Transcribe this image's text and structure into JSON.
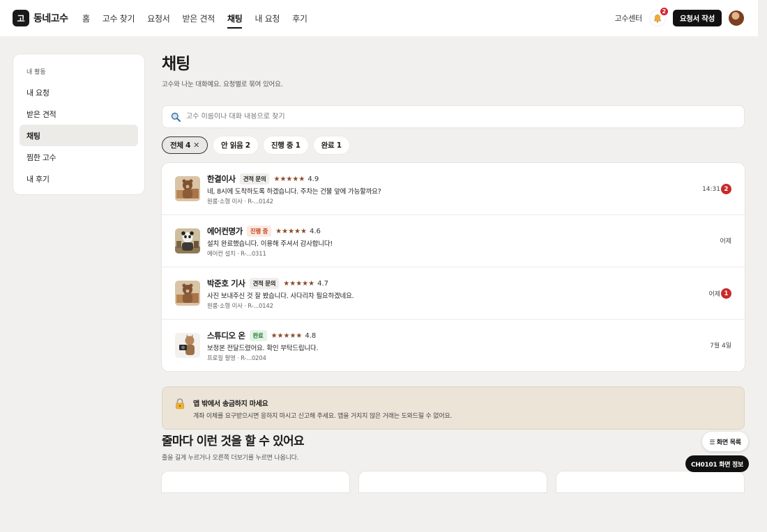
{
  "header": {
    "logo_char": "고",
    "brand": "동네고수",
    "nav": [
      {
        "label": "홈",
        "active": false
      },
      {
        "label": "고수 찾기",
        "active": false
      },
      {
        "label": "요청서",
        "active": false
      },
      {
        "label": "받은 견적",
        "active": false
      },
      {
        "label": "채팅",
        "active": true
      },
      {
        "label": "내 요청",
        "active": false
      },
      {
        "label": "후기",
        "active": false
      }
    ],
    "center_link": "고수센터",
    "notification_count": "2",
    "write_button": "요청서 작성"
  },
  "sidebar": {
    "heading": "내 활동",
    "items": [
      {
        "label": "내 요청",
        "active": false
      },
      {
        "label": "받은 견적",
        "active": false
      },
      {
        "label": "채팅",
        "active": true
      },
      {
        "label": "찜한 고수",
        "active": false
      },
      {
        "label": "내 후기",
        "active": false
      }
    ]
  },
  "page": {
    "title": "채팅",
    "subtitle": "고수와 나눈 대화예요. 요청별로 묶여 있어요."
  },
  "search": {
    "placeholder": "고수 이름이나 대화 내용으로 찾기",
    "value": ""
  },
  "filters": [
    {
      "label": "전체 4",
      "active": true
    },
    {
      "label": "안 읽음 2",
      "active": false
    },
    {
      "label": "진행 중 1",
      "active": false
    },
    {
      "label": "완료 1",
      "active": false
    }
  ],
  "chats": [
    {
      "name": "한결이사",
      "tag": "견적 문의",
      "tag_style": "gray",
      "stars": "★★★★★",
      "rating": "4.9",
      "message": "네, 8시에 도착하도록 하겠습니다. 주차는 건물 앞에 가능할까요?",
      "meta": "원룸·소형 이사 · R-...0142",
      "time": "14:31",
      "unread": "2",
      "thumb": "bear-boxes"
    },
    {
      "name": "에어컨명가",
      "tag": "진행 중",
      "tag_style": "orange",
      "stars": "★★★★★",
      "rating": "4.6",
      "message": "설치 완료했습니다. 이용해 주셔서 감사합니다!",
      "meta": "에어컨 설치 · R-...0311",
      "time": "어제",
      "unread": "",
      "thumb": "panda-worker"
    },
    {
      "name": "박준호 기사",
      "tag": "견적 문의",
      "tag_style": "gray",
      "stars": "★★★★★",
      "rating": "4.7",
      "message": "사진 보내주신 것 잘 봤습니다. 사다리차 필요하겠네요.",
      "meta": "원룸·소형 이사 · R-...0142",
      "time": "어제",
      "unread": "1",
      "thumb": "bear-boxes"
    },
    {
      "name": "스튜디오 온",
      "tag": "완료",
      "tag_style": "green",
      "stars": "★★★★★",
      "rating": "4.8",
      "message": "보정본 전달드렸어요. 확인 부탁드립니다.",
      "meta": "프로필 촬영 · R-...0204",
      "time": "7월 4일",
      "unread": "",
      "thumb": "cat-camera"
    }
  ],
  "notice": {
    "title": "앱 밖에서 송금하지 마세요",
    "body": "계좌 이체를 요구받으시면 응하지 마시고 신고해 주세요. 앱을 거치지 않은 거래는 도와드릴 수 없어요."
  },
  "section": {
    "title": "줄마다 이런 것을 할 수 있어요",
    "subtitle": "줄을 길게 누르거나 오른쪽 더보기를 누르면 나옵니다."
  },
  "floating": {
    "screen_list": "☰ 화면 목록",
    "screen_info": "CH0101 화면 정보"
  }
}
